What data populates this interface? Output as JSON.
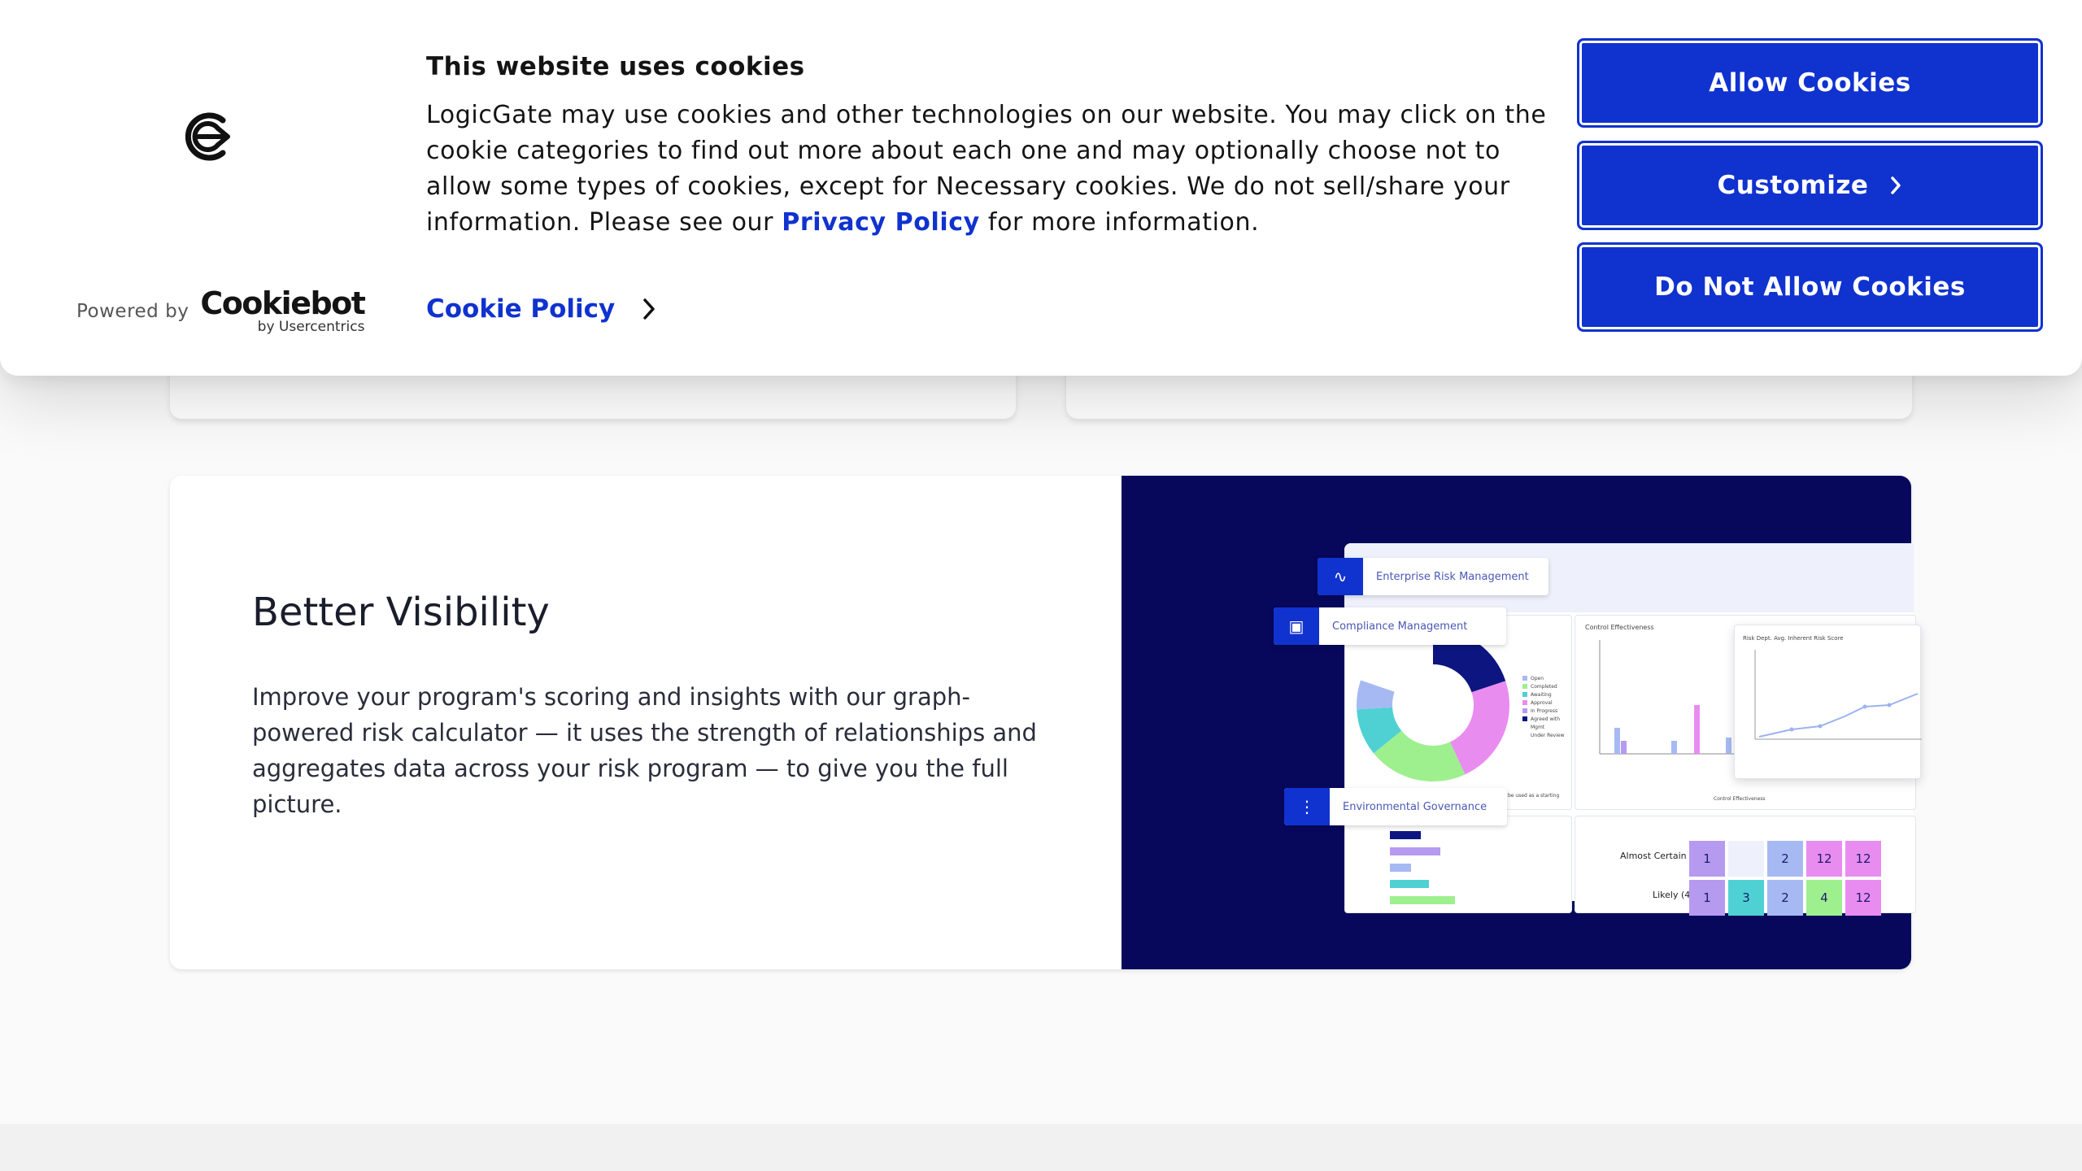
{
  "banner": {
    "title": "This website uses cookies",
    "text_part1": "LogicGate may use cookies and other technologies on our website. You may click on the cookie categories to find out more about each one and may optionally choose not to allow some types of cookies, except for Necessary cookies.  We do not sell/share your information. Please see our ",
    "privacy_link": "Privacy Policy",
    "text_part2": " for more information.",
    "cookie_policy_link": "Cookie Policy",
    "powered_by": "Powered by",
    "brand_name": "Cookiebot",
    "brand_sub": "by Usercentrics",
    "buttons": {
      "allow": "Allow Cookies",
      "customize": "Customize",
      "deny": "Do Not Allow Cookies"
    },
    "icons": {
      "logo": "logicgate-logo-icon",
      "customize_chevron": "chevron-right-icon",
      "policy_chevron": "chevron-right-icon"
    },
    "colors": {
      "accent": "#1032cf",
      "button_text": "#ffffff"
    }
  },
  "feature": {
    "title": "Better Visibility",
    "body": "Improve your program's scoring and insights with our graph-powered risk calculator — it uses the strength of relationships and aggregates data across your risk program — to give you the full picture."
  },
  "mockup": {
    "pills": [
      "Enterprise Risk Management",
      "Compliance Management",
      "Environmental Governance"
    ],
    "chart_titles": [
      "Control Effectiveness",
      "Risk Dept. Avg. Inherent Risk Score"
    ],
    "legend": [
      "Open",
      "Completed",
      "Awaiting Approval",
      "In Progress",
      "Agreed with Mgmt",
      "Under Review"
    ],
    "heatmap_rows": [
      {
        "label": "Almost Certain (5)",
        "values": [
          "1",
          "",
          "2",
          "12",
          "12"
        ]
      },
      {
        "label": "Likely (4)",
        "values": [
          "1",
          "3",
          "2",
          "4",
          "12"
        ]
      }
    ],
    "bar_caption": "Control Effectiveness",
    "starting_note": "be used as a starting"
  },
  "colors": {
    "page_bg": "#fafafa",
    "image_bg": "#07085c",
    "footer_bg": "#f1f1f1"
  }
}
